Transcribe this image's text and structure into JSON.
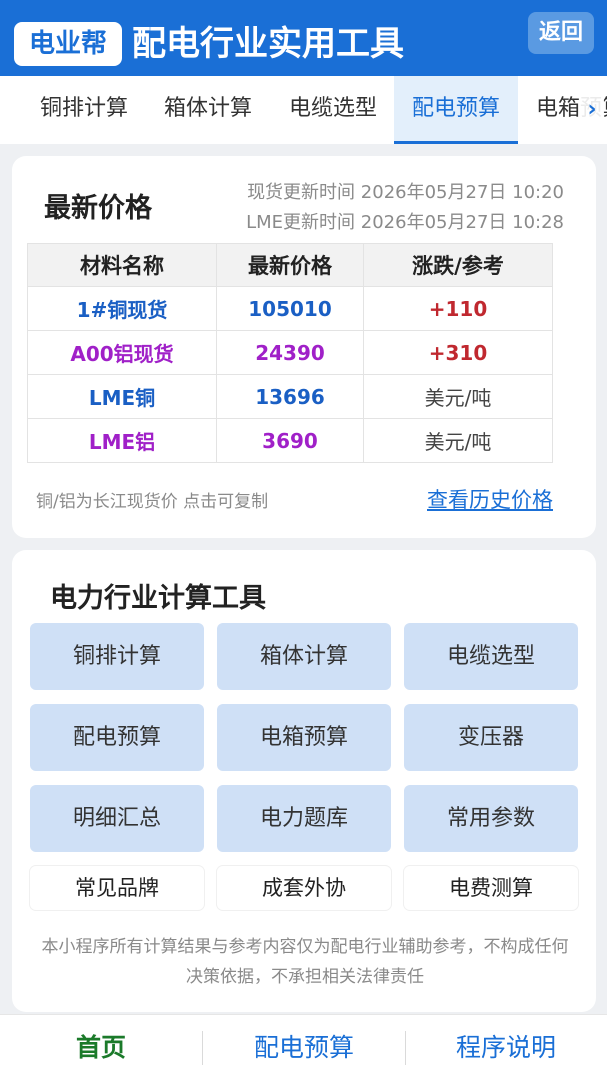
{
  "header": {
    "logo": "电业帮",
    "title": "配电行业实用工具",
    "back_label": "返回"
  },
  "tabs": [
    {
      "label": "铜排计算"
    },
    {
      "label": "箱体计算"
    },
    {
      "label": "电缆选型"
    },
    {
      "label": "配电预算",
      "active": true
    },
    {
      "label": "电箱预算"
    }
  ],
  "tabs_more_icon": "chevron-right-icon",
  "price": {
    "title": "最新价格",
    "spot_update": "现货更新时间 2026年05月27日 10:20",
    "lme_update": "LME更新时间 2026年05月27日 10:28",
    "columns": [
      "材料名称",
      "最新价格",
      "涨跌/参考"
    ],
    "rows": [
      {
        "name": "1#铜现货",
        "price": "105010",
        "change": "+110"
      },
      {
        "name": "A00铝现货",
        "price": "24390",
        "change": "+310"
      },
      {
        "name": "LME铜",
        "price": "13696",
        "change": "美元/吨"
      },
      {
        "name": "LME铝",
        "price": "3690",
        "change": "美元/吨"
      }
    ],
    "note": "铜/铝为长江现货价 点击可复制",
    "history_link": "查看历史价格"
  },
  "tools": {
    "title": "电力行业计算工具",
    "buttons": [
      "铜排计算",
      "箱体计算",
      "电缆选型",
      "配电预算",
      "电箱预算",
      "变压器",
      "明细汇总",
      "电力题库",
      "常用参数"
    ],
    "plain": [
      "常见品牌",
      "成套外协",
      "电费测算"
    ],
    "disclaimer": "本小程序所有计算结果与参考内容仅为配电行业辅助参考，不构成任何决策依据，不承担相关法律责任"
  },
  "bottom_nav": [
    {
      "label": "首页",
      "active": true
    },
    {
      "label": "配电预算"
    },
    {
      "label": "程序说明"
    }
  ],
  "colors": {
    "brand_blue": "#1a6fd6",
    "tool_button_bg": "#cfe0f6",
    "copper_text": "#1a5fc4",
    "aluminum_text": "#a020c8",
    "rise_text": "#c0282f",
    "active_nav": "#1b7a2a"
  }
}
